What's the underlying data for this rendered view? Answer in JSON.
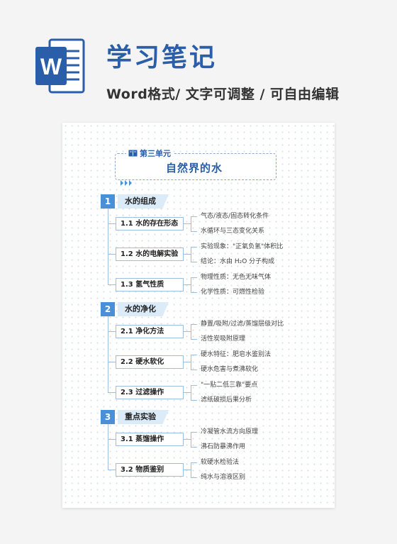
{
  "header": {
    "title": "学习笔记",
    "subtitle": "Word格式/ 文字可调整 / 可自由编辑",
    "word_icon_letter": "W",
    "brand_color": "#2a5ea8"
  },
  "unit": {
    "tag": "第三单元",
    "title": "自然界的水"
  },
  "sections": [
    {
      "num": "1",
      "label": "水的组成",
      "subs": [
        {
          "label": "1.1  水的存在形态",
          "leaves": [
            "气态/液态/固态转化条件",
            "水循环与三态变化关系"
          ]
        },
        {
          "label": "1.2  水的电解实验",
          "leaves": [
            "实验现象：\"正氧负氢\"体积比",
            "结论：水由 H₂O 分子构成"
          ]
        },
        {
          "label": "1.3  氢气性质",
          "leaves": [
            "物理性质：无色无味气体",
            "化学性质：可燃性检验"
          ]
        }
      ]
    },
    {
      "num": "2",
      "label": "水的净化",
      "subs": [
        {
          "label": "2.1  净化方法",
          "leaves": [
            "静置/吸附/过滤/蒸馏层级对比",
            "活性炭吸附原理"
          ]
        },
        {
          "label": "2.2  硬水软化",
          "leaves": [
            "硬水特征：肥皂水鉴别法",
            "硬水危害与煮沸软化"
          ]
        },
        {
          "label": "2.3  过滤操作",
          "leaves": [
            "\"一贴二低三靠\"要点",
            "滤纸破损后果分析"
          ]
        }
      ]
    },
    {
      "num": "3",
      "label": "重点实验",
      "subs": [
        {
          "label": "3.1  蒸馏操作",
          "leaves": [
            "冷凝管水流方向原理",
            "沸石防暴沸作用"
          ]
        },
        {
          "label": "3.2  物质鉴别",
          "leaves": [
            "软硬水检验法",
            "纯水与溶液区别"
          ]
        }
      ]
    }
  ]
}
